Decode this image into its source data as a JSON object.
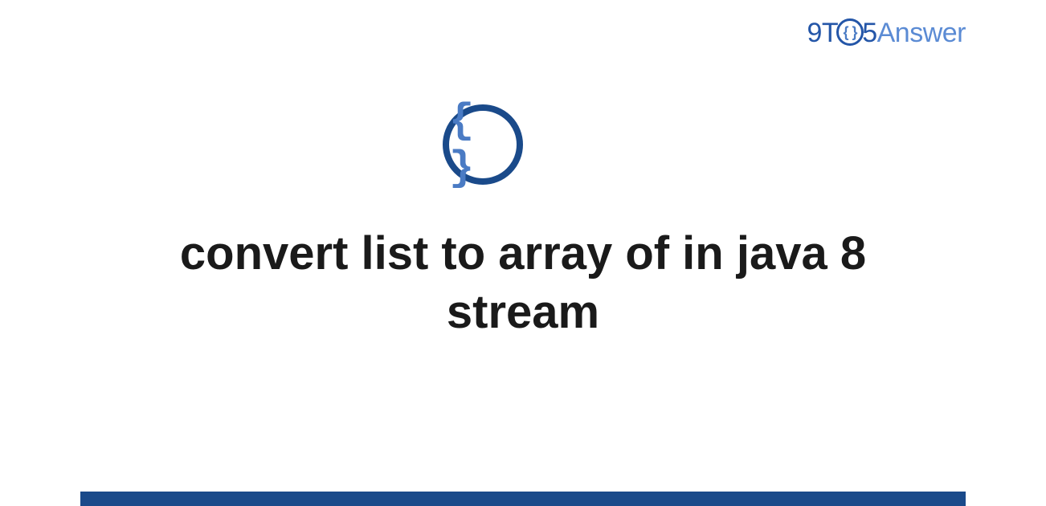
{
  "header": {
    "logo_part1": "9T",
    "logo_circle": "{ }",
    "logo_part2": "5",
    "logo_part3": "Answer"
  },
  "main": {
    "icon_content": "{ }",
    "title": "convert list to array of in java 8 stream"
  }
}
